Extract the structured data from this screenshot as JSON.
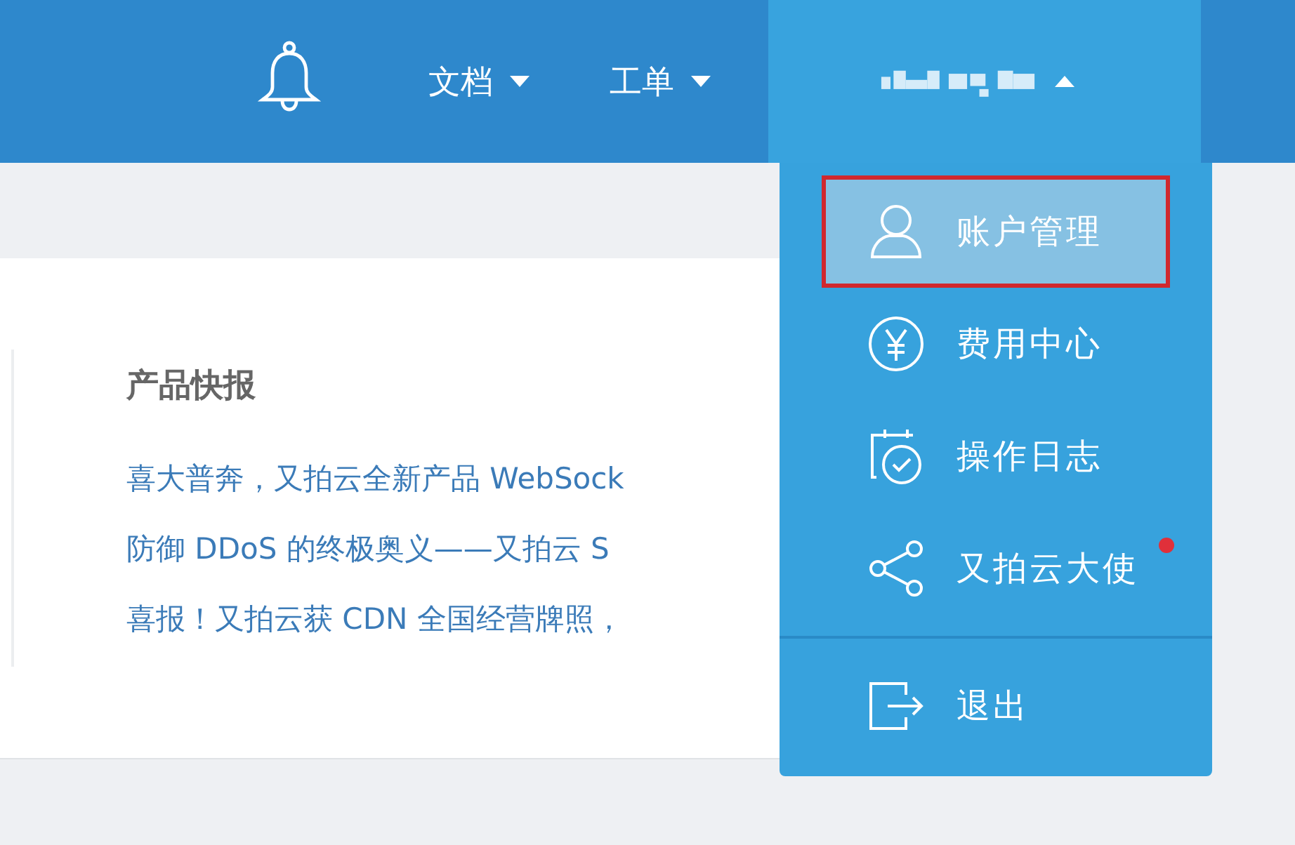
{
  "header": {
    "nav": [
      {
        "label": "文档",
        "expanded": false
      },
      {
        "label": "工单",
        "expanded": false
      }
    ],
    "user_menu": {
      "expanded": true
    }
  },
  "user_dropdown": {
    "items": [
      {
        "label": "账户管理",
        "kind": "user",
        "selected": true,
        "marked": true,
        "badge": false
      },
      {
        "label": "费用中心",
        "kind": "yen",
        "selected": false,
        "marked": false,
        "badge": false
      },
      {
        "label": "操作日志",
        "kind": "clock",
        "selected": false,
        "marked": false,
        "badge": false
      },
      {
        "label": "又拍云大使",
        "kind": "share",
        "selected": false,
        "marked": false,
        "badge": true
      }
    ],
    "footer_item": {
      "label": "退出",
      "kind": "logout"
    }
  },
  "news": {
    "title": "产品快报",
    "links": [
      "喜大普奔，又拍云全新产品 WebSock",
      "防御 DDoS 的终极奥义——又拍云 S",
      "喜报！又拍云获 CDN 全国经营牌照，"
    ]
  }
}
